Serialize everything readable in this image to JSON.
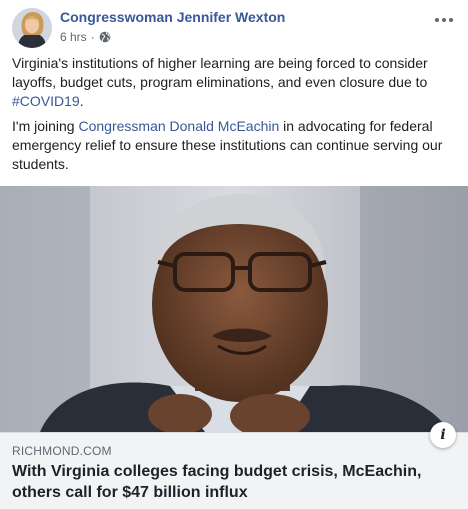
{
  "post": {
    "author": "Congresswoman Jennifer Wexton",
    "timestamp": "6 hrs",
    "separator": "·",
    "privacy_icon": "globe-icon",
    "more_icon": "more-options-icon",
    "paragraph1": {
      "text": "Virginia's institutions of higher learning are being forced to consider layoffs, budget cuts, program eliminations, and even closure due to ",
      "hashtag": "#COVID19",
      "end": "."
    },
    "paragraph2": {
      "before": "I'm joining ",
      "mention": "Congressman Donald McEachin",
      "after": " in advocating for federal emergency relief to ensure these institutions can continue serving our students."
    }
  },
  "link_card": {
    "domain": "RICHMOND.COM",
    "title": "With Virginia colleges facing budget crisis, McEachin, others call for $47 billion influx",
    "info_label": "i"
  },
  "colors": {
    "link": "#385898",
    "meta": "#606770",
    "card_bg": "#f2f3f5"
  }
}
